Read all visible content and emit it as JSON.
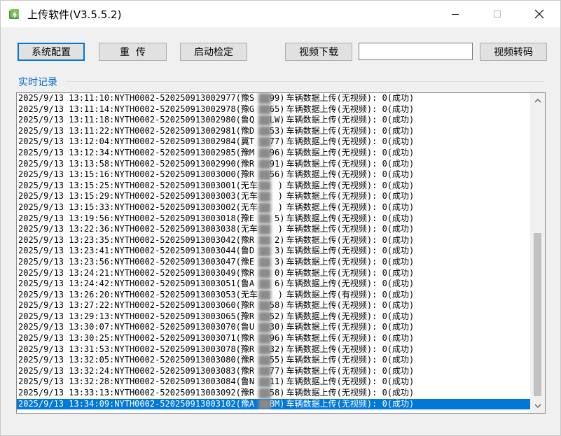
{
  "window": {
    "title": "上传软件(V3.5.5.2)"
  },
  "toolbar": {
    "config_label": "系统配置",
    "reupload_label": "重  传",
    "check_label": "启动检定",
    "video_download_label": "视频下载",
    "video_input_value": "",
    "video_convert_label": "视频转码"
  },
  "log_group": {
    "label": "实时记录",
    "rows": [
      {
        "time": "2025/9/13 13:11:10",
        "code": "NYTH0002-520250913002977",
        "plate": "(豫S   99)",
        "msg": "车辆数据上传(无视频): 0(成功)"
      },
      {
        "time": "2025/9/13 13:11:14",
        "code": "NYTH0002-520250913002978",
        "plate": "(豫G   65)",
        "msg": "车辆数据上传(无视频): 0(成功)"
      },
      {
        "time": "2025/9/13 13:11:18",
        "code": "NYTH0002-520250913002980",
        "plate": "(鲁Q   LW)",
        "msg": "车辆数据上传(无视频): 0(成功)"
      },
      {
        "time": "2025/9/13 13:11:22",
        "code": "NYTH0002-520250913002981",
        "plate": "(豫D   53)",
        "msg": "车辆数据上传(无视频): 0(成功)"
      },
      {
        "time": "2025/9/13 13:12:04",
        "code": "NYTH0002-520250913002984",
        "plate": "(冀T   77)",
        "msg": "车辆数据上传(无视频): 0(成功)"
      },
      {
        "time": "2025/9/13 13:12:34",
        "code": "NYTH0002-520250913002985",
        "plate": "(豫M   96)",
        "msg": "车辆数据上传(无视频): 0(成功)"
      },
      {
        "time": "2025/9/13 13:13:58",
        "code": "NYTH0002-520250913002990",
        "plate": "(豫R   91)",
        "msg": "车辆数据上传(无视频): 0(成功)"
      },
      {
        "time": "2025/9/13 13:15:16",
        "code": "NYTH0002-520250913003000",
        "plate": "(豫R   56)",
        "msg": "车辆数据上传(无视频): 0(成功)"
      },
      {
        "time": "2025/9/13 13:15:25",
        "code": "NYTH0002-520250913003001",
        "plate": "(无车    )",
        "msg": "车辆数据上传(无视频): 0(成功)"
      },
      {
        "time": "2025/9/13 13:15:29",
        "code": "NYTH0002-520250913003003",
        "plate": "(无车    )",
        "msg": "车辆数据上传(无视频): 0(成功)"
      },
      {
        "time": "2025/9/13 13:15:33",
        "code": "NYTH0002-520250913003002",
        "plate": "(无车    )",
        "msg": "车辆数据上传(无视频): 0(成功)"
      },
      {
        "time": "2025/9/13 13:19:56",
        "code": "NYTH0002-520250913003018",
        "plate": "(豫E    5)",
        "msg": "车辆数据上传(无视频): 0(成功)"
      },
      {
        "time": "2025/9/13 13:22:36",
        "code": "NYTH0002-520250913003038",
        "plate": "(无车    )",
        "msg": "车辆数据上传(无视频): 0(成功)"
      },
      {
        "time": "2025/9/13 13:23:35",
        "code": "NYTH0002-520250913003042",
        "plate": "(豫R    2)",
        "msg": "车辆数据上传(无视频): 0(成功)"
      },
      {
        "time": "2025/9/13 13:23:41",
        "code": "NYTH0002-520250913003044",
        "plate": "(鲁D    3)",
        "msg": "车辆数据上传(无视频): 0(成功)"
      },
      {
        "time": "2025/9/13 13:23:56",
        "code": "NYTH0002-520250913003047",
        "plate": "(豫E    3)",
        "msg": "车辆数据上传(无视频): 0(成功)"
      },
      {
        "time": "2025/9/13 13:24:21",
        "code": "NYTH0002-520250913003049",
        "plate": "(豫R    0)",
        "msg": "车辆数据上传(无视频): 0(成功)"
      },
      {
        "time": "2025/9/13 13:24:42",
        "code": "NYTH0002-520250913003051",
        "plate": "(鲁A    6)",
        "msg": "车辆数据上传(无视频): 0(成功)"
      },
      {
        "time": "2025/9/13 13:26:20",
        "code": "NYTH0002-520250913003053",
        "plate": "(无车    )",
        "msg": "车辆数据上传(有视频): 0(成功)"
      },
      {
        "time": "2025/9/13 13:27:22",
        "code": "NYTH0002-520250913003060",
        "plate": "(豫R   58)",
        "msg": "车辆数据上传(无视频): 0(成功)"
      },
      {
        "time": "2025/9/13 13:29:13",
        "code": "NYTH0002-520250913003065",
        "plate": "(豫R   52)",
        "msg": "车辆数据上传(无视频): 0(成功)"
      },
      {
        "time": "2025/9/13 13:30:07",
        "code": "NYTH0002-520250913003070",
        "plate": "(鲁U   30)",
        "msg": "车辆数据上传(无视频): 0(成功)"
      },
      {
        "time": "2025/9/13 13:30:25",
        "code": "NYTH0002-520250913003071",
        "plate": "(豫R   96)",
        "msg": "车辆数据上传(无视频): 0(成功)"
      },
      {
        "time": "2025/9/13 13:31:53",
        "code": "NYTH0002-520250913003078",
        "plate": "(豫R   32)",
        "msg": "车辆数据上传(无视频): 0(成功)"
      },
      {
        "time": "2025/9/13 13:32:05",
        "code": "NYTH0002-520250913003080",
        "plate": "(豫R   55)",
        "msg": "车辆数据上传(无视频): 0(成功)"
      },
      {
        "time": "2025/9/13 13:32:24",
        "code": "NYTH0002-520250913003083",
        "plate": "(豫R   77)",
        "msg": "车辆数据上传(无视频): 0(成功)"
      },
      {
        "time": "2025/9/13 13:32:28",
        "code": "NYTH0002-520250913003084",
        "plate": "(鲁N   11)",
        "msg": "车辆数据上传(无视频): 0(成功)"
      },
      {
        "time": "2025/9/13 13:33:13",
        "code": "NYTH0002-520250913003092",
        "plate": "(豫R   58)",
        "msg": "车辆数据上传(无视频): 0(成功)"
      },
      {
        "time": "2025/9/13 13:34:09",
        "code": "NYTH0002-520250913003102",
        "plate": "(豫A   BM)",
        "msg": "车辆数据上传(无视频): 0(成功)"
      }
    ],
    "selected_index": 28
  },
  "colors": {
    "selection": "#0078d7",
    "group_label": "#0066cc",
    "icon_green": "#2e8b2e"
  }
}
